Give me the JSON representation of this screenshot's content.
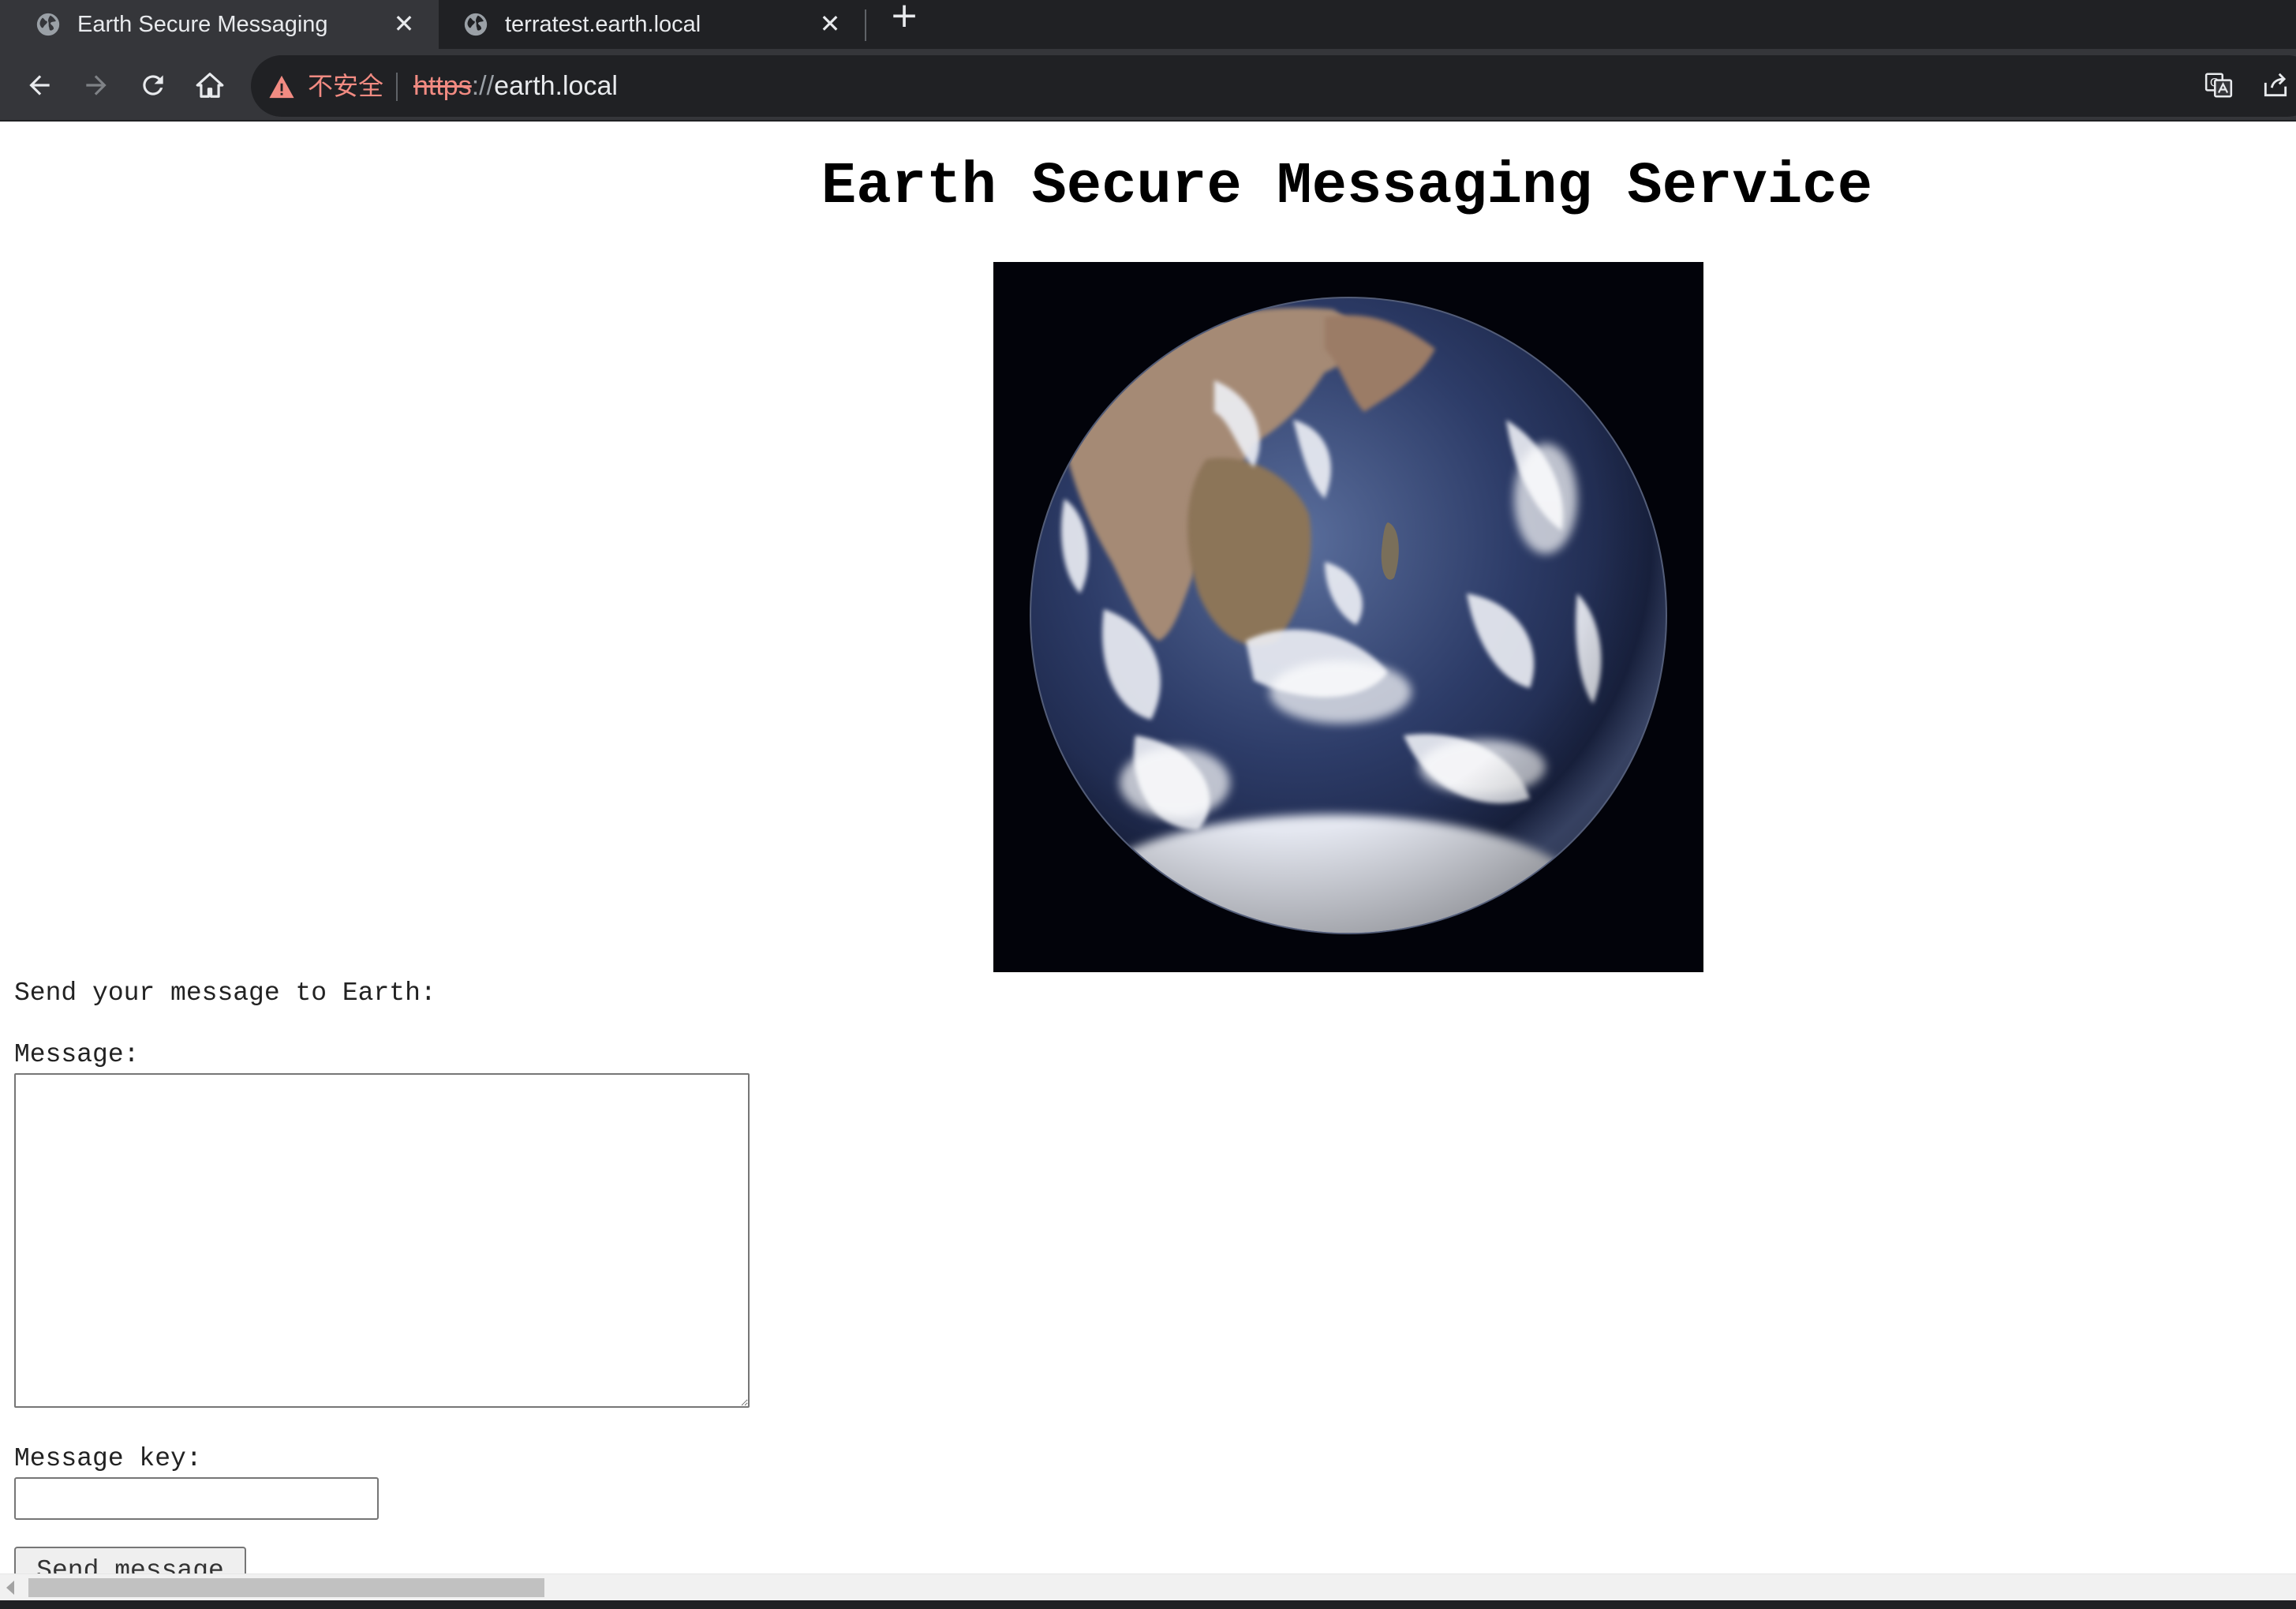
{
  "browser": {
    "tabs": [
      {
        "title": "Earth Secure Messaging",
        "active": true,
        "icon": "globe-icon"
      },
      {
        "title": "terratest.earth.local",
        "active": false,
        "icon": "globe-icon"
      }
    ],
    "new_tab_symbol": "+",
    "close_symbol": "✕",
    "security_label": "不安全",
    "url": {
      "scheme": "https",
      "separator": "://",
      "host": "earth.local"
    }
  },
  "page": {
    "title": "Earth Secure Messaging Service",
    "image_icon": "earth-globe-image",
    "form": {
      "intro": "Send your message to Earth:",
      "message_label": "Message:",
      "message_value": "",
      "key_label": "Message key:",
      "key_value": "",
      "submit_label": "Send message"
    }
  },
  "colors": {
    "chrome_dark": "#202124",
    "chrome_toolbar": "#35363a",
    "insecure_red": "#f28b82",
    "page_bg": "#ffffff"
  }
}
